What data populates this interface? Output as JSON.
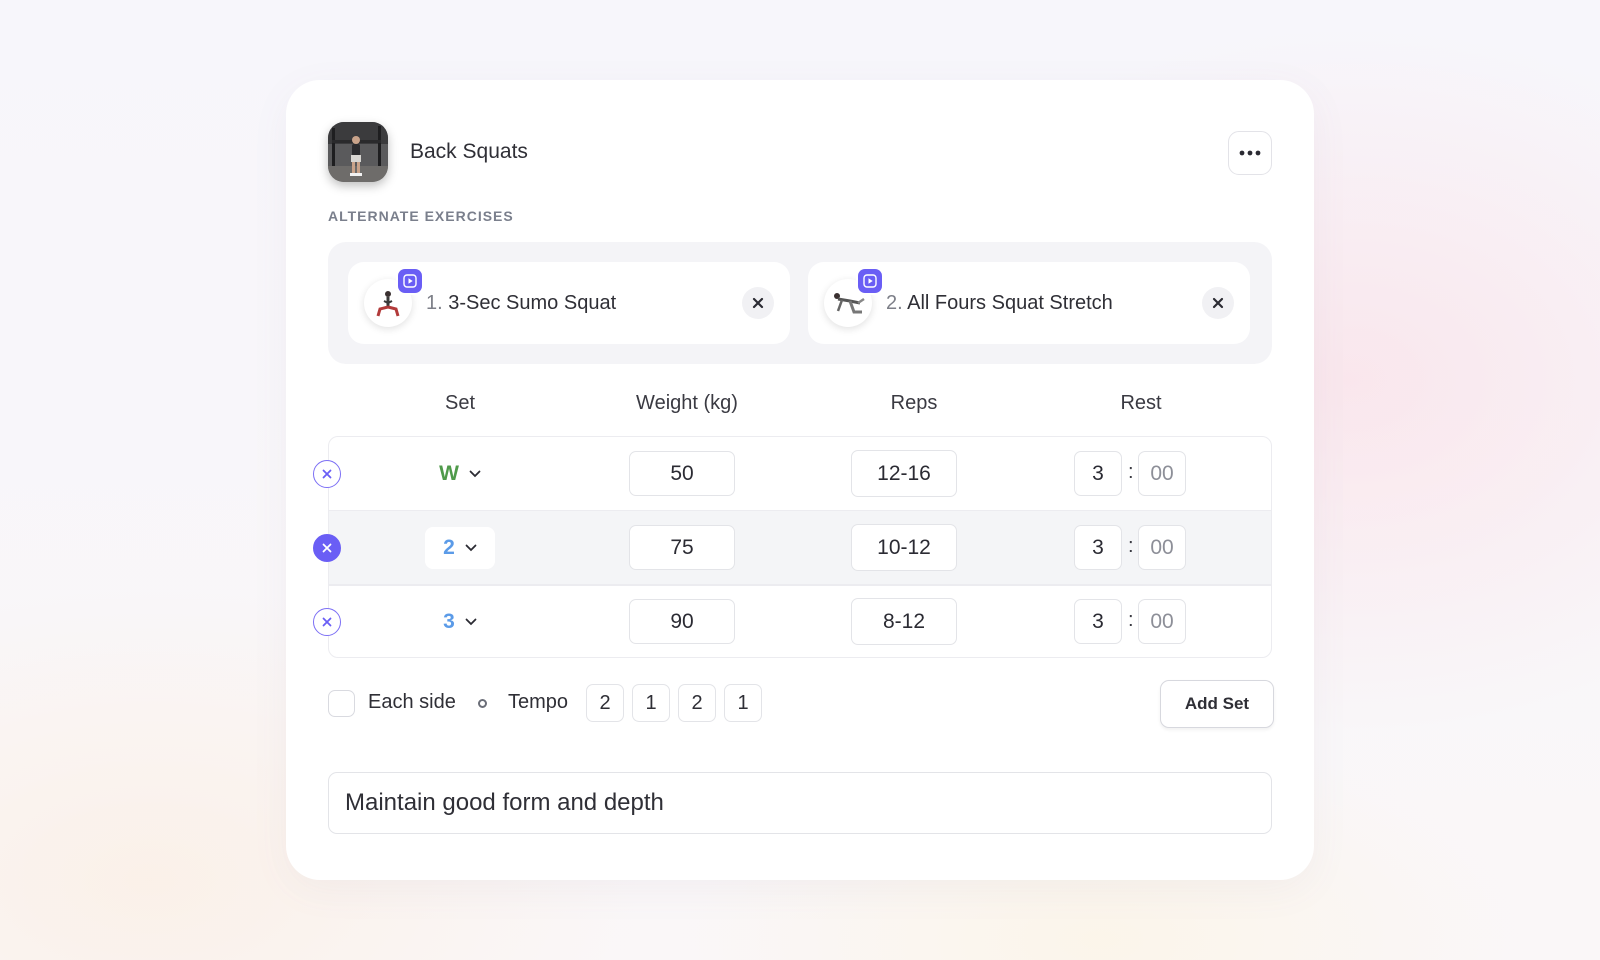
{
  "exercise": {
    "title": "Back Squats",
    "menu_icon": "more-horizontal-icon"
  },
  "alternates": {
    "section_label": "ALTERNATE EXERCISES",
    "items": [
      {
        "number": "1.",
        "name": "3-Sec Sumo Squat",
        "play_icon": "play-icon",
        "remove_icon": "close-icon"
      },
      {
        "number": "2.",
        "name": "All Fours Squat Stretch",
        "play_icon": "play-icon",
        "remove_icon": "close-icon"
      }
    ]
  },
  "table": {
    "headers": {
      "set": "Set",
      "weight": "Weight (kg)",
      "reps": "Reps",
      "rest": "Rest"
    },
    "rows": [
      {
        "set": "W",
        "set_color": "#4f9a4a",
        "weight": "50",
        "reps": "12-16",
        "rest_min": "3",
        "rest_sec": "00"
      },
      {
        "set": "2",
        "set_color": "#5b9be8",
        "weight": "75",
        "reps": "10-12",
        "rest_min": "3",
        "rest_sec": "00"
      },
      {
        "set": "3",
        "set_color": "#5b9be8",
        "weight": "90",
        "reps": "8-12",
        "rest_min": "3",
        "rest_sec": "00"
      }
    ],
    "separator": ":"
  },
  "footer": {
    "each_side_label": "Each side",
    "each_side_checked": false,
    "tempo_label": "Tempo",
    "tempo": [
      "2",
      "1",
      "2",
      "1"
    ],
    "add_set_label": "Add Set"
  },
  "notes": "Maintain good form and depth",
  "colors": {
    "accent": "#6a5ef5"
  }
}
